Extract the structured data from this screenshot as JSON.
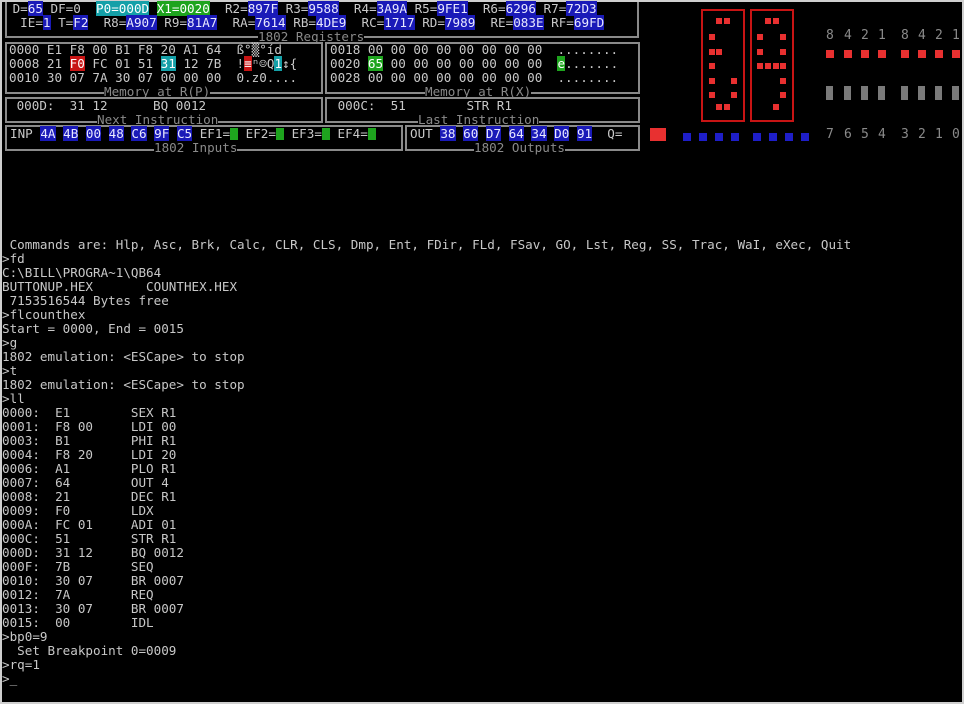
{
  "registers": {
    "caption": "1802 Registers",
    "row1": [
      {
        "label": " D=",
        "value": "65",
        "style": "hl-blue"
      },
      {
        "label": " DF=",
        "value": "0",
        "style": "none"
      },
      {
        "label": "  ",
        "value": "P0=000D",
        "style": "hl-cyan"
      },
      {
        "label": " ",
        "value": "X1=0020",
        "style": "hl-green"
      },
      {
        "label": "  R2=",
        "value": "897F",
        "style": "hl-blue"
      },
      {
        "label": " R3=",
        "value": "9588",
        "style": "hl-blue"
      },
      {
        "label": "  R4=",
        "value": "3A9A",
        "style": "hl-blue"
      },
      {
        "label": " R5=",
        "value": "9FE1",
        "style": "hl-blue"
      },
      {
        "label": "  R6=",
        "value": "6296",
        "style": "hl-blue"
      },
      {
        "label": " R7=",
        "value": "72D3",
        "style": "hl-blue"
      }
    ],
    "row2": [
      {
        "label": "  IE=",
        "value": "1",
        "style": "hl-blue"
      },
      {
        "label": " T=",
        "value": "F2",
        "style": "hl-blue"
      },
      {
        "label": "  R8=",
        "value": "A907",
        "style": "hl-blue"
      },
      {
        "label": " R9=",
        "value": "81A7",
        "style": "hl-blue"
      },
      {
        "label": "  RA=",
        "value": "7614",
        "style": "hl-blue"
      },
      {
        "label": " RB=",
        "value": "4DE9",
        "style": "hl-blue"
      },
      {
        "label": "  RC=",
        "value": "1717",
        "style": "hl-blue"
      },
      {
        "label": " RD=",
        "value": "7989",
        "style": "hl-blue"
      },
      {
        "label": "  RE=",
        "value": "083E",
        "style": "hl-blue"
      },
      {
        "label": " RF=",
        "value": "69FD",
        "style": "hl-blue"
      }
    ]
  },
  "memory_rp": {
    "caption": "Memory at R(P)",
    "rows": [
      [
        {
          "t": "0000 E1 F8 00 B1 F8 20 A1 64  ß°▒°íd"
        }
      ],
      [
        {
          "t": "0008 21 "
        },
        {
          "t": "F0",
          "s": "hl-red"
        },
        {
          "t": " FC 01 51 "
        },
        {
          "t": "31",
          "s": "hl-cyan"
        },
        {
          "t": " 12 7B  !"
        },
        {
          "t": "≡",
          "s": "hl-red"
        },
        {
          "t": "ⁿ☺Q"
        },
        {
          "t": "1",
          "s": "hl-cyan"
        },
        {
          "t": "↕{"
        }
      ],
      [
        {
          "t": "0010 30 07 7A 30 07 00 00 00  0.z0...."
        }
      ]
    ]
  },
  "memory_rx": {
    "caption": "Memory at R(X)",
    "rows": [
      [
        {
          "t": "0018 00 00 00 00 00 00 00 00  ........"
        }
      ],
      [
        {
          "t": "0020 "
        },
        {
          "t": "65",
          "s": "hl-green"
        },
        {
          "t": " 00 00 00 00 00 00 00  "
        },
        {
          "t": "e",
          "s": "hl-green"
        },
        {
          "t": "......."
        }
      ],
      [
        {
          "t": "0028 00 00 00 00 00 00 00 00  ........"
        }
      ]
    ]
  },
  "next_instruction": {
    "caption": "Next Instruction",
    "text": " 000D:  31 12      BQ 0012"
  },
  "last_instruction": {
    "caption": "Last Instruction",
    "text": " 000C:  51        STR R1"
  },
  "inputs": {
    "caption": "1802 Inputs",
    "label": "INP",
    "bytes": [
      "4A",
      "4B",
      "00",
      "48",
      "C6",
      "9F",
      "C5"
    ],
    "flags": [
      "EF1=",
      "EF2=",
      "EF3=",
      "EF4="
    ]
  },
  "outputs": {
    "caption": "1802 Outputs",
    "label": "OUT",
    "bytes": [
      "38",
      "60",
      "D7",
      "64",
      "34",
      "D0",
      "91"
    ],
    "q_label": "Q="
  },
  "bits_top": [
    "8",
    "4",
    "2",
    "1",
    "8",
    "4",
    "2",
    "1"
  ],
  "bits_bottom": [
    "7",
    "6",
    "5",
    "4",
    "3",
    "2",
    "1",
    "0"
  ],
  "colors": {
    "led_red": "#e83030",
    "led_blue": "#1e1ec8",
    "led_gray": "#7a7a7a",
    "frame_red": "#c81414"
  },
  "console": [
    " Commands are: Hlp, Asc, Brk, Calc, CLR, CLS, Dmp, Ent, FDir, FLd, FSav, GO, Lst, Reg, SS, Trac, WaI, eXec, Quit",
    ">fd",
    "C:\\BILL\\PROGRA~1\\QB64",
    "BUTTONUP.HEX       COUNTHEX.HEX",
    " 7153516544 Bytes free",
    ">flcounthex",
    "Start = 0000, End = 0015",
    ">g",
    "1802 emulation: <ESCape> to stop",
    ">t",
    "1802 emulation: <ESCape> to stop",
    ">ll",
    "0000:  E1        SEX R1",
    "0001:  F8 00     LDI 00",
    "0003:  B1        PHI R1",
    "0004:  F8 20     LDI 20",
    "0006:  A1        PLO R1",
    "0007:  64        OUT 4",
    "0008:  21        DEC R1",
    "0009:  F0        LDX",
    "000A:  FC 01     ADI 01",
    "000C:  51        STR R1",
    "000D:  31 12     BQ 0012",
    "000F:  7B        SEQ",
    "0010:  30 07     BR 0007",
    "0012:  7A        REQ",
    "0013:  30 07     BR 0007",
    "0015:  00        IDL",
    ">bp0=9",
    "  Set Breakpoint 0=0009",
    ">rq=1",
    ">_"
  ]
}
